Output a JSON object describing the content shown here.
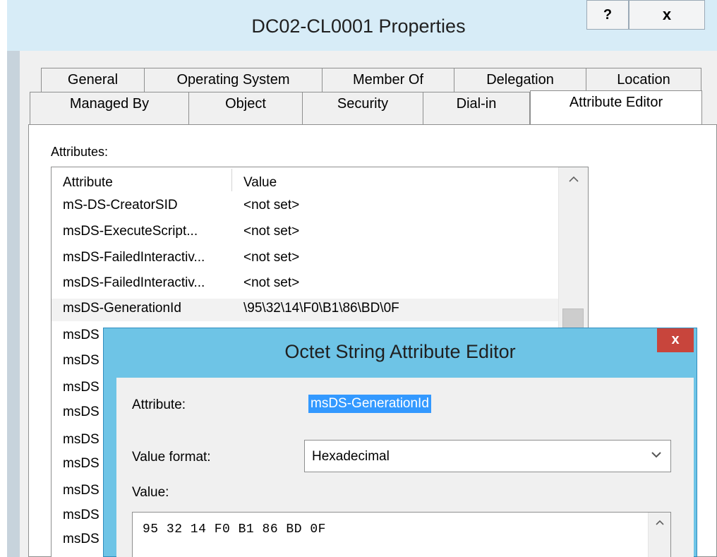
{
  "window": {
    "title": "DC02-CL0001 Properties",
    "help_label": "?",
    "close_label": "x"
  },
  "tabs": {
    "row1": [
      "General",
      "Operating System",
      "Member Of",
      "Delegation",
      "Location"
    ],
    "row2": [
      "Managed By",
      "Object",
      "Security",
      "Dial-in",
      "Attribute Editor"
    ],
    "selected": "Attribute Editor"
  },
  "attributes": {
    "label": "Attributes:",
    "columns": [
      "Attribute",
      "Value"
    ],
    "rows": [
      [
        "mS-DS-CreatorSID",
        "<not set>"
      ],
      [
        "msDS-ExecuteScript...",
        "<not set>"
      ],
      [
        "msDS-FailedInteractiv...",
        "<not set>"
      ],
      [
        "msDS-FailedInteractiv...",
        "<not set>"
      ],
      [
        "msDS-GenerationId",
        "\\95\\32\\14\\F0\\B1\\86\\BD\\0F"
      ],
      [
        "msDS",
        ""
      ],
      [
        "msDS",
        ""
      ],
      [
        "msDS",
        ""
      ],
      [
        "msDS",
        ""
      ],
      [
        "msDS",
        ""
      ],
      [
        "msDS",
        ""
      ],
      [
        "msDS",
        ""
      ],
      [
        "msDS",
        ""
      ],
      [
        "msDS",
        ""
      ]
    ],
    "selected_index": 4,
    "scroll_up_icon": "chevron-up-icon"
  },
  "dialog": {
    "title": "Octet String Attribute Editor",
    "close_label": "x",
    "attribute_label": "Attribute:",
    "attribute_value": "msDS-GenerationId",
    "format_label": "Value format:",
    "format_value": "Hexadecimal",
    "format_chevron_icon": "chevron-down-icon",
    "value_label": "Value:",
    "value_text": "95 32 14 F0 B1 86 BD 0F"
  },
  "colors": {
    "frame": "#6ec4e6",
    "close_red": "#c8453c",
    "selection": "#3399ff"
  }
}
